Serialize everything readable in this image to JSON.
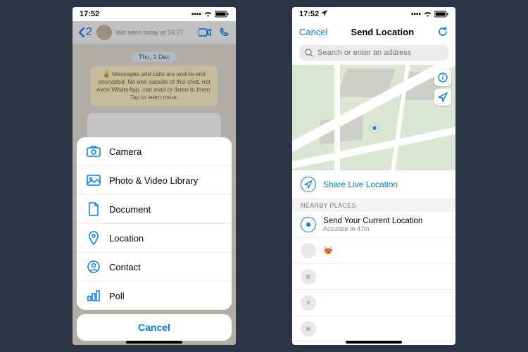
{
  "phoneA": {
    "status": {
      "time": "17:52"
    },
    "header": {
      "back_count": "2",
      "last_seen": "last seen today at 16:27"
    },
    "chat": {
      "date": "Thu, 1 Dec",
      "encryption_notice": "🔒 Messages and calls are end-to-end encrypted. No one outside of this chat, not even WhatsApp, can read or listen to them. Tap to learn more."
    },
    "sheet": {
      "items": [
        {
          "label": "Camera",
          "icon": "camera-icon"
        },
        {
          "label": "Photo & Video Library",
          "icon": "photo-icon"
        },
        {
          "label": "Document",
          "icon": "document-icon"
        },
        {
          "label": "Location",
          "icon": "location-icon"
        },
        {
          "label": "Contact",
          "icon": "contact-icon"
        },
        {
          "label": "Poll",
          "icon": "poll-icon"
        }
      ],
      "cancel": "Cancel"
    }
  },
  "phoneB": {
    "status": {
      "time": "17:52"
    },
    "header": {
      "cancel": "Cancel",
      "title": "Send Location"
    },
    "search": {
      "placeholder": "Search or enter an address"
    },
    "live_location": "Share Live Location",
    "section_header": "NEARBY PLACES",
    "current": {
      "title": "Send Your Current Location",
      "subtitle": "Accurate to 47m"
    },
    "places": [
      {
        "emoji": "😻"
      },
      {
        "emoji": ""
      },
      {
        "emoji": ""
      },
      {
        "emoji": ""
      }
    ]
  }
}
